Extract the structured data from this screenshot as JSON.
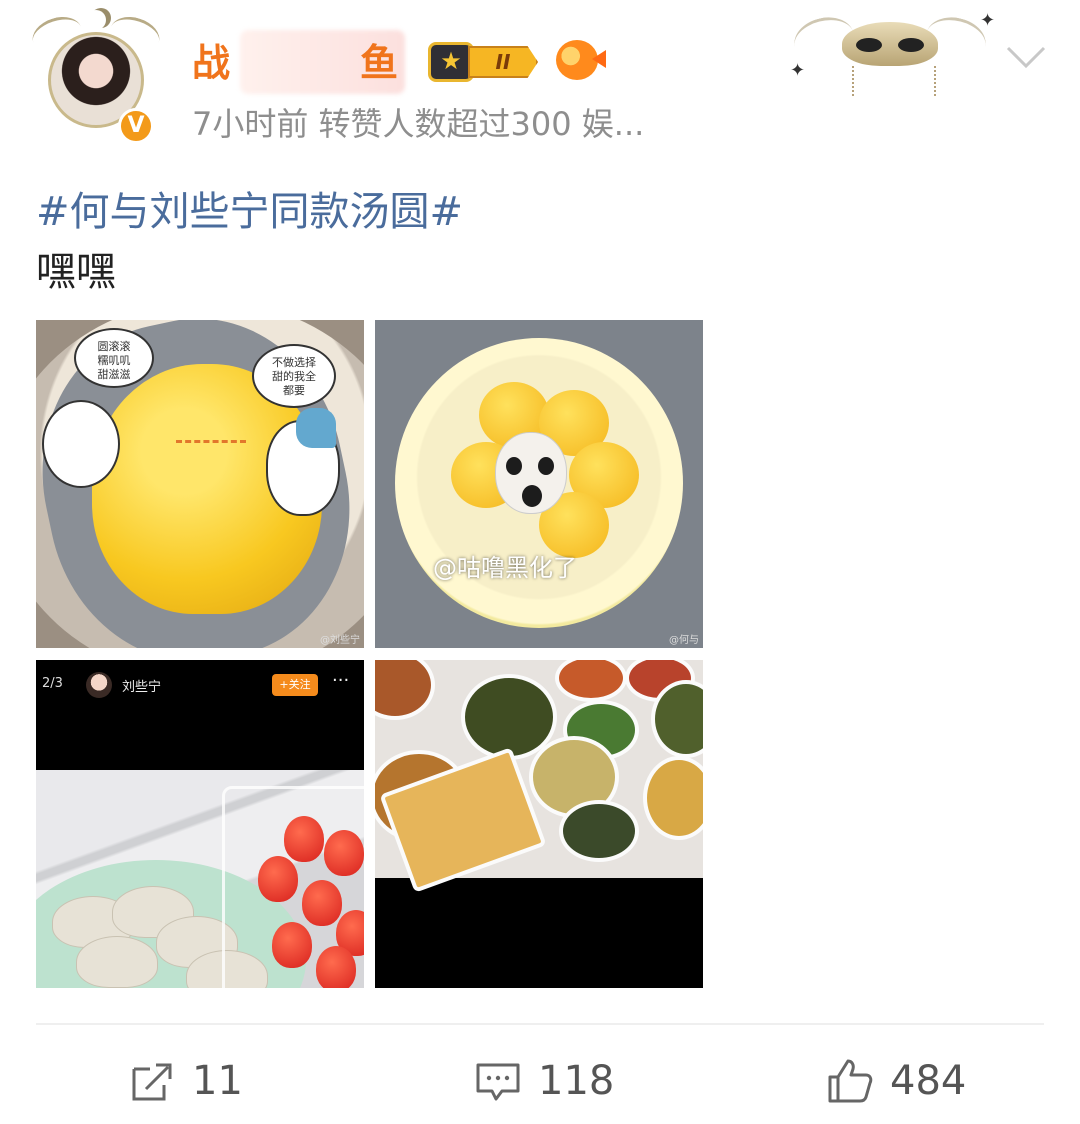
{
  "post": {
    "author": {
      "name_visible_start": "战",
      "name_visible_end": "鱼",
      "vip_level": "II"
    },
    "meta": "7小时前  转赞人数超过300   娱...",
    "hashtag": "#何与刘些宁同款汤圆#",
    "text": "嘿嘿"
  },
  "images": {
    "image1": {
      "bubble_left": "圆滚滚\n糯叽叽\n甜滋滋",
      "bubble_right": "不做选择\n甜的我全\n都要",
      "watermark": "@刘些宁"
    },
    "image2": {
      "overlay": "@咕噜黑化了",
      "watermark": "@何与"
    },
    "image3": {
      "counter": "2/3",
      "username": "刘些宁",
      "follow_label": "+关注",
      "more": "···"
    }
  },
  "actions": {
    "share_count": "11",
    "comment_count": "118",
    "like_count": "484"
  },
  "icons": {
    "expand": "chevron-down-icon",
    "share": "share-icon",
    "comment": "comment-icon",
    "like": "thumbs-up-icon",
    "verified": "verified-v-icon",
    "vip": "crown-icon"
  },
  "colors": {
    "username": "#f0741c",
    "hashtag": "#4a6c9c",
    "meta": "#8e8e8e",
    "verified_badge": "#f39a1a"
  }
}
